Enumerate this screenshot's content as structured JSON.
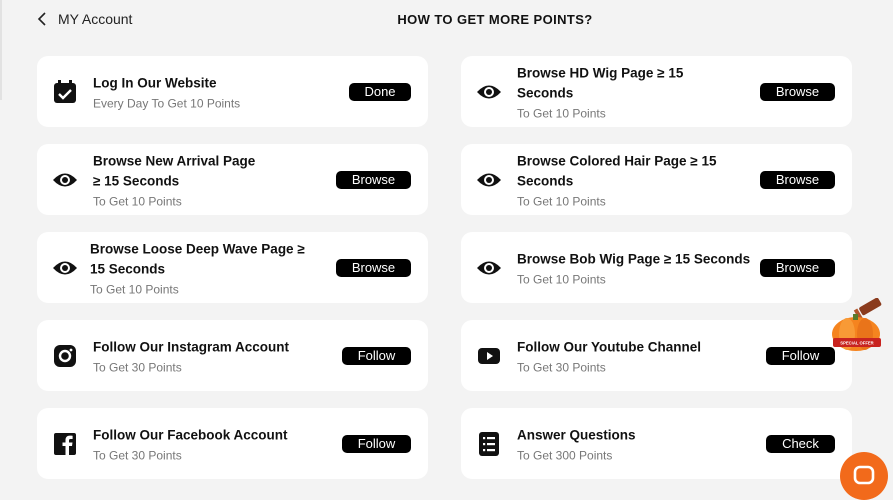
{
  "header": {
    "back_label": "MY Account",
    "title": "HOW TO GET MORE POINTS?"
  },
  "tasks": [
    {
      "name": "Log In Our Website",
      "sub": "Every Day To Get 10 Points",
      "button": "Done",
      "icon": "calendar-check-icon"
    },
    {
      "name": "Browse HD Wig Page ≥ 15 Seconds",
      "sub": "To Get 10 Points",
      "button": "Browse",
      "icon": "eye-icon"
    },
    {
      "name": "Browse New Arrival Page ≥ 15 Seconds",
      "sub": "To Get 10 Points",
      "button": "Browse",
      "icon": "eye-icon"
    },
    {
      "name": "Browse Colored Hair Page ≥ 15 Seconds",
      "sub": "To Get 10 Points",
      "button": "Browse",
      "icon": "eye-icon"
    },
    {
      "name": "Browse Loose Deep Wave Page ≥ 15 Seconds",
      "sub": "To Get 10 Points",
      "button": "Browse",
      "icon": "eye-icon"
    },
    {
      "name": "Browse Bob Wig Page ≥ 15 Seconds",
      "sub": "To Get 10 Points",
      "button": "Browse",
      "icon": "eye-icon"
    },
    {
      "name": "Follow Our Instagram Account",
      "sub": "To Get 30 Points",
      "button": "Follow",
      "icon": "instagram-icon"
    },
    {
      "name": "Follow Our Youtube Channel",
      "sub": "To Get 30 Points",
      "button": "Follow",
      "icon": "youtube-icon"
    },
    {
      "name": "Follow Our Facebook Account",
      "sub": "To Get 30 Points",
      "button": "Follow",
      "icon": "facebook-icon"
    },
    {
      "name": "Answer Questions",
      "sub": "To Get 300 Points",
      "button": "Check",
      "icon": "list-icon"
    }
  ],
  "promo_badge": {
    "icon": "pumpkin-hammer-icon",
    "text": "SPECIAL OFFER FOR HALLOWEEN"
  },
  "chat": {
    "icon": "chat-icon"
  },
  "colors": {
    "background": "#f3f3f3",
    "card": "#ffffff",
    "button": "#000000",
    "accent": "#f26a1b"
  }
}
